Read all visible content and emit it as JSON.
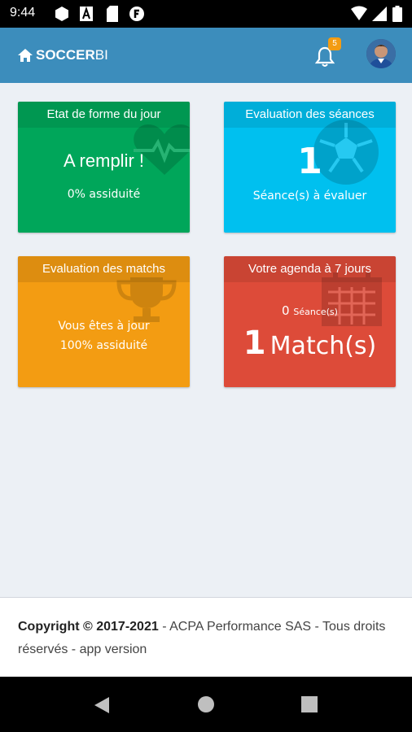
{
  "status_bar": {
    "time": "9:44",
    "icons": [
      "hexagon-icon",
      "a-box-icon",
      "sim-icon",
      "f-circle-icon",
      "wifi-icon",
      "signal-icon",
      "battery-icon"
    ]
  },
  "header": {
    "brand_bold": "SOCCER",
    "brand_light": "BI",
    "notification_count": "5",
    "accent_color": "#3c8dbc"
  },
  "cards": {
    "fitness": {
      "title": "Etat de forme du jour",
      "main": "A remplir !",
      "sub": "0% assiduité",
      "color": "#00a65a",
      "icon": "heartbeat-icon"
    },
    "sessions": {
      "title": "Evaluation des séances",
      "count": "1",
      "sub": "Séance(s) à évaluer",
      "color": "#00c0ef",
      "icon": "soccer-ball-icon"
    },
    "matches": {
      "title": "Evaluation des matchs",
      "line1": "Vous êtes à jour",
      "line2": "100% assiduité",
      "color": "#f39c12",
      "icon": "trophy-icon"
    },
    "agenda": {
      "title": "Votre agenda à 7 jours",
      "session_count": "0",
      "session_label": "Séance(s)",
      "match_count": "1",
      "match_label": "Match(s)",
      "color": "#dd4b39",
      "icon": "calendar-icon"
    }
  },
  "footer": {
    "copyright": "Copyright © 2017-2021",
    "rest": " - ACPA Performance SAS - Tous droits réservés - app version"
  },
  "nav_bar": {
    "icons": [
      "back-icon",
      "home-icon",
      "recents-icon"
    ]
  }
}
